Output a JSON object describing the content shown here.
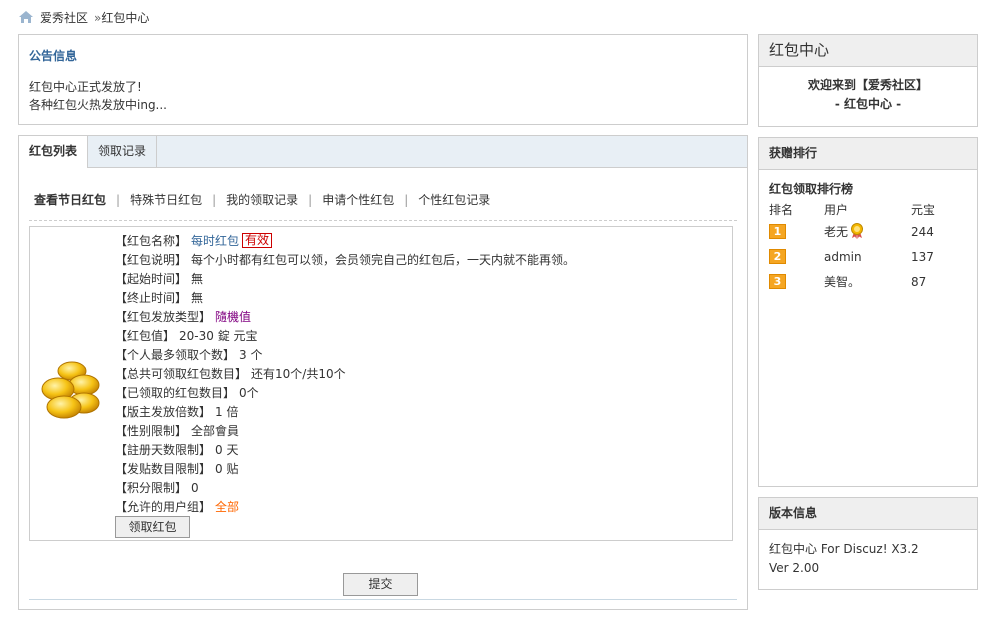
{
  "breadcrumb": {
    "home_icon": "home-icon",
    "site": "爱秀社区",
    "separator": "»",
    "current": "红包中心"
  },
  "notice": {
    "title": "公告信息",
    "lines": [
      "红包中心正式发放了!",
      "各种红包火热发放中ing..."
    ]
  },
  "main": {
    "tabs": [
      {
        "label": "红包列表",
        "active": true
      },
      {
        "label": "领取记录",
        "active": false
      }
    ],
    "subnav": [
      "查看节日红包",
      "特殊节日红包",
      "我的领取记录",
      "申请个性红包",
      "个性红包记录"
    ],
    "subnav_sep": "|",
    "packet": {
      "icon": "gold-coins-icon",
      "fields": [
        {
          "key": "【红包名称】",
          "value": "每时红包",
          "badge": "有效"
        },
        {
          "key": "【红包说明】",
          "value": "每个小时都有红包可以领，会员领完自己的红包后，一天内就不能再领。"
        },
        {
          "key": "【起始时间】",
          "value": "無"
        },
        {
          "key": "【终止时间】",
          "value": "無"
        },
        {
          "key": "【红包发放类型】",
          "value": "隨機值"
        },
        {
          "key": "【红包值】",
          "value": "20-30 錠  元宝"
        },
        {
          "key": "【个人最多领取个数】",
          "value": "3 个"
        },
        {
          "key": "【总共可领取红包数目】",
          "value": "还有10个/共10个"
        },
        {
          "key": "【已领取的红包数目】",
          "value": "0个"
        },
        {
          "key": "【版主发放倍数】",
          "value": "1 倍"
        },
        {
          "key": "【性别限制】",
          "value": "全部會員"
        },
        {
          "key": "【註册天数限制】",
          "value": "0 天"
        },
        {
          "key": "【发贴数目限制】",
          "value": "0 贴"
        },
        {
          "key": "【积分限制】",
          "value": "0"
        },
        {
          "key": "【允许的用户组】",
          "value": "全部"
        }
      ],
      "claim_button": "领取红包"
    },
    "submit_button": "提交"
  },
  "side_center": {
    "title": "红包中心",
    "welcome_line1": "欢迎来到【爱秀社区】",
    "welcome_line2": "- 红包中心 -"
  },
  "side_rank": {
    "title": "获赠排行",
    "subtitle": "红包领取排行榜",
    "headers": [
      "排名",
      "用户",
      "元宝"
    ],
    "rows": [
      {
        "rank": "1",
        "user": "老无",
        "medal": "medal-icon",
        "amount": "244"
      },
      {
        "rank": "2",
        "user": "admin",
        "amount": "137"
      },
      {
        "rank": "3",
        "user": "美智。",
        "amount": "87"
      }
    ]
  },
  "side_version": {
    "title": "版本信息",
    "line1": "红包中心 For Discuz! X3.2",
    "line2": "Ver 2.00"
  },
  "colors": {
    "link_blue": "#336699",
    "accent_orange": "#ff6600",
    "purple": "#800080",
    "valid_red": "#cc0000",
    "rank_gold": "#f5a623"
  }
}
